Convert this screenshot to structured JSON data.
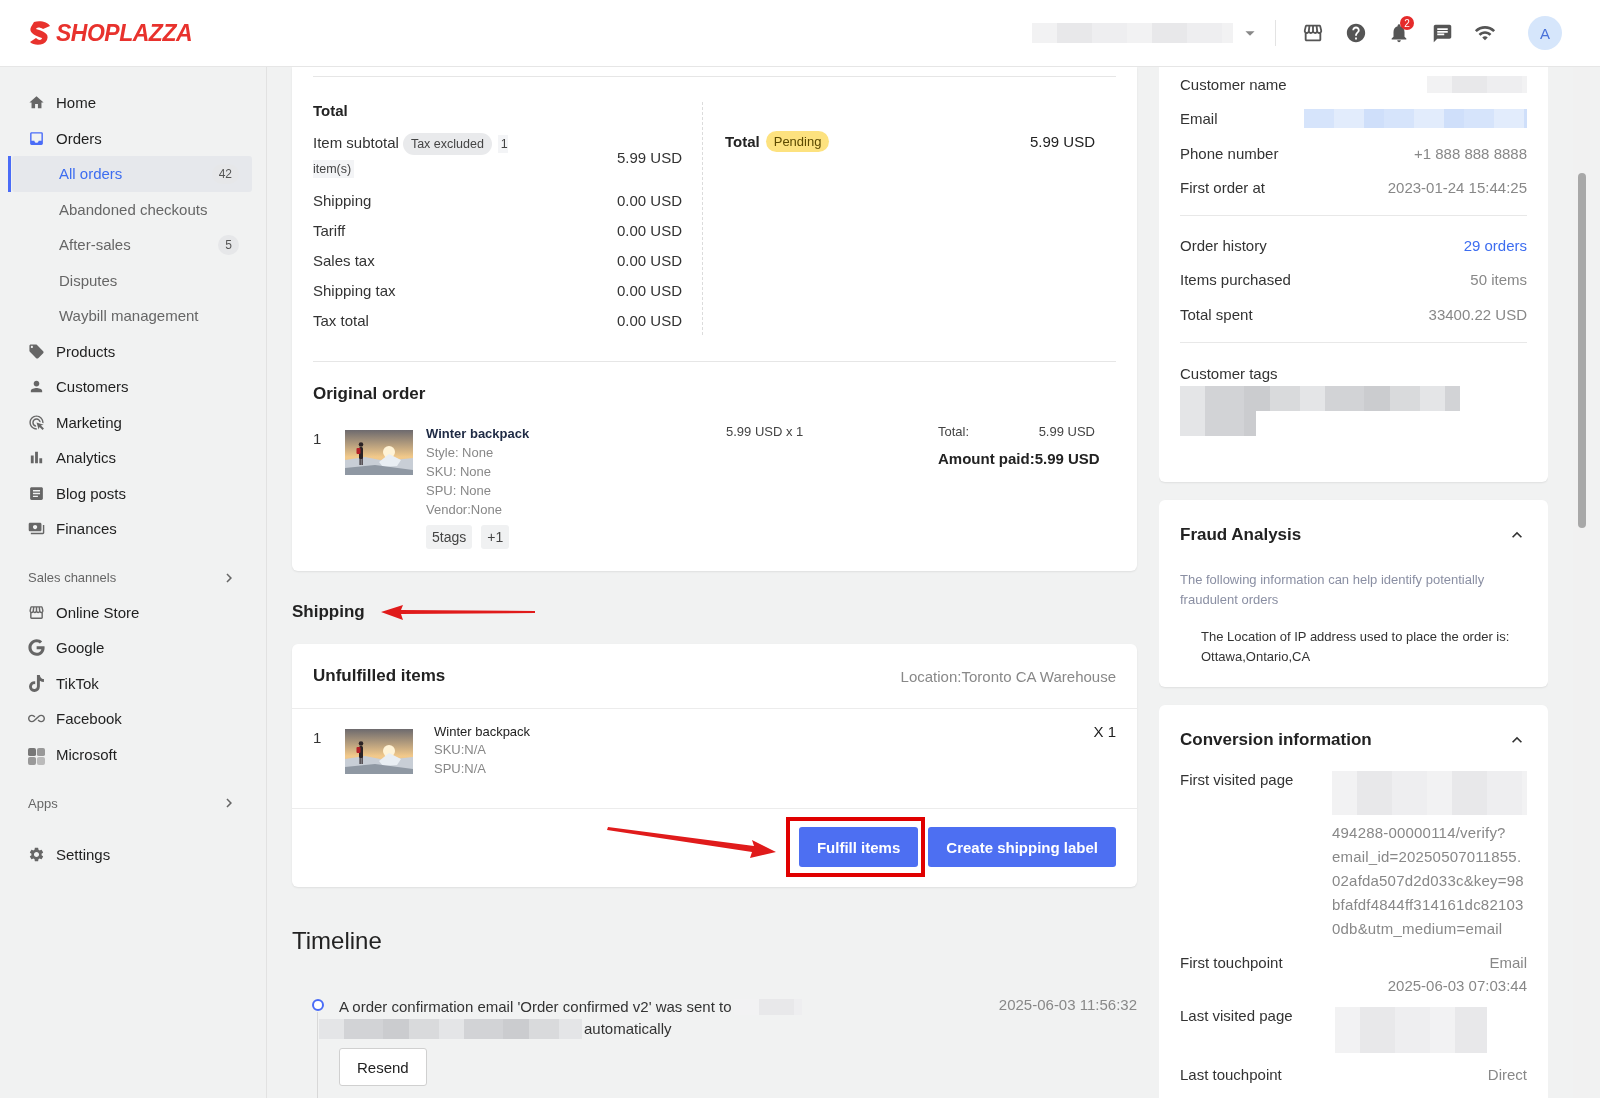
{
  "topbar": {
    "logo": "SHOPLAZZA",
    "notifications": "2",
    "avatar": "A"
  },
  "sidebar": {
    "groups": [
      {
        "items": [
          {
            "label": "Home",
            "selected": false
          },
          {
            "label": "Orders",
            "selected": false,
            "expanded": true,
            "children": [
              {
                "label": "All orders",
                "selected": true,
                "count": "42"
              },
              {
                "label": "Abandoned checkouts",
                "selected": false
              },
              {
                "label": "After-sales",
                "selected": false,
                "count": "5"
              },
              {
                "label": "Disputes",
                "selected": false
              },
              {
                "label": "Waybill management",
                "selected": false
              }
            ]
          },
          {
            "label": "Products",
            "selected": false
          },
          {
            "label": "Customers",
            "selected": false
          },
          {
            "label": "Marketing",
            "selected": false
          },
          {
            "label": "Analytics",
            "selected": false
          },
          {
            "label": "Blog posts",
            "selected": false
          },
          {
            "label": "Finances",
            "selected": false
          }
        ]
      },
      {
        "heading": "Sales channels",
        "items": [
          {
            "label": "Online Store",
            "selected": false
          },
          {
            "label": "Google",
            "selected": false
          },
          {
            "label": "TikTok",
            "selected": false
          },
          {
            "label": "Facebook",
            "selected": false
          },
          {
            "label": "Microsoft",
            "selected": false
          }
        ]
      },
      {
        "heading": "Apps"
      },
      {
        "items": [
          {
            "label": "Settings",
            "selected": false
          }
        ]
      }
    ]
  },
  "totals": {
    "title": "Total",
    "subtotal": {
      "label": "Item subtotal",
      "badge": "Tax excluded",
      "count": "1 item(s)",
      "amount": "5.99 USD"
    },
    "lines": [
      {
        "label": "Shipping",
        "amount": "0.00 USD"
      },
      {
        "label": "Tariff",
        "amount": "0.00 USD"
      },
      {
        "label": "Sales tax",
        "amount": "0.00 USD"
      },
      {
        "label": "Shipping tax",
        "amount": "0.00 USD"
      },
      {
        "label": "Tax total",
        "amount": "0.00 USD"
      }
    ],
    "total": {
      "label": "Total",
      "status": "Pending",
      "amount": "5.99 USD"
    }
  },
  "original_order": {
    "title": "Original order",
    "items": [
      {
        "index": "1",
        "name": "Winter backpack",
        "details": [
          "Style: None",
          "SKU: None",
          "SPU: None",
          "Vendor:None"
        ],
        "tags": [
          "5tags",
          "+1"
        ],
        "price": "5.99 USD x 1",
        "total_label": "Total:",
        "total": "5.99 USD",
        "paid": "Amount paid:5.99 USD"
      }
    ]
  },
  "shipping": {
    "title": "Shipping",
    "arrow": true,
    "card": {
      "title": "Unfulfilled items",
      "location": "Location:Toronto CA Warehouse",
      "items": [
        {
          "index": "1",
          "name": "Winter backpack",
          "details": [
            "SKU:N/A",
            "SPU:N/A"
          ],
          "quantity": "X 1"
        }
      ],
      "buttons": [
        {
          "label": "Fulfill items",
          "highlighted": true,
          "arrow": true
        },
        {
          "label": "Create shipping label",
          "highlighted": false,
          "arrow": false
        }
      ]
    }
  },
  "timeline": {
    "title": "Timeline",
    "events": [
      {
        "message": "A order confirmation email 'Order confirmed v2' was sent to",
        "message_end": "automatically",
        "time": "2025-06-03 11:56:32",
        "button": "Resend"
      }
    ]
  },
  "customer": {
    "sections": [
      {
        "rows": [
          {
            "label": "Customer name",
            "kind": "redacted"
          },
          {
            "label": "Email",
            "kind": "redacted_link"
          },
          {
            "label": "Phone number",
            "kind": "text",
            "value": "+1 888 888 8888"
          },
          {
            "label": "First order at",
            "kind": "text",
            "value": "2023-01-24 15:44:25"
          }
        ]
      },
      {
        "rows": [
          {
            "label": "Order history",
            "kind": "link",
            "value": "29 orders"
          },
          {
            "label": "Items purchased",
            "kind": "text",
            "value": "50 items"
          },
          {
            "label": "Total spent",
            "kind": "text",
            "value": "33400.22 USD"
          }
        ]
      }
    ],
    "tags_title": "Customer tags"
  },
  "fraud": {
    "title": "Fraud Analysis",
    "expanded": true,
    "description": "The following information can help identify potentially fraudulent orders",
    "note": "The Location of IP address used to place the order is: Ottawa,Ontario,CA"
  },
  "conversion": {
    "title": "Conversion information",
    "expanded": true,
    "rows": [
      {
        "label": "First visited page",
        "kind": "redacted_url",
        "value": "494288-00000114/verify?email_id=20250507011855.02afda507d2d033c&key=98bfafdf4844ff314161dc821030db&utm_medium=email"
      },
      {
        "label": "First touchpoint",
        "kind": "text",
        "value": "Email",
        "detail": "2025-06-03 07:03:44"
      },
      {
        "label": "Last visited page",
        "kind": "redacted"
      },
      {
        "label": "Last touchpoint",
        "kind": "text",
        "value": "Direct"
      }
    ]
  }
}
